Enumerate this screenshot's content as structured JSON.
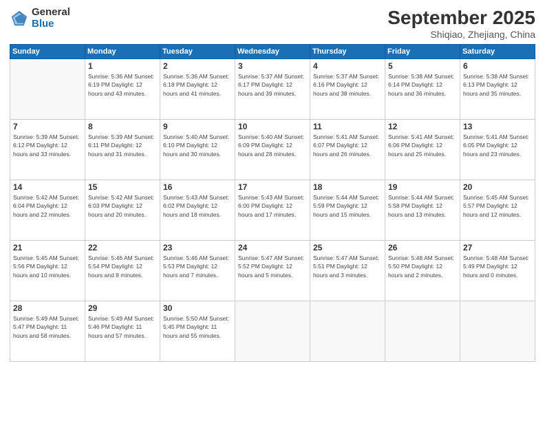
{
  "header": {
    "logo_general": "General",
    "logo_blue": "Blue",
    "month_title": "September 2025",
    "location": "Shiqiao, Zhejiang, China"
  },
  "weekdays": [
    "Sunday",
    "Monday",
    "Tuesday",
    "Wednesday",
    "Thursday",
    "Friday",
    "Saturday"
  ],
  "weeks": [
    [
      {
        "day": "",
        "info": ""
      },
      {
        "day": "1",
        "info": "Sunrise: 5:36 AM\nSunset: 6:19 PM\nDaylight: 12 hours\nand 43 minutes."
      },
      {
        "day": "2",
        "info": "Sunrise: 5:36 AM\nSunset: 6:18 PM\nDaylight: 12 hours\nand 41 minutes."
      },
      {
        "day": "3",
        "info": "Sunrise: 5:37 AM\nSunset: 6:17 PM\nDaylight: 12 hours\nand 39 minutes."
      },
      {
        "day": "4",
        "info": "Sunrise: 5:37 AM\nSunset: 6:16 PM\nDaylight: 12 hours\nand 38 minutes."
      },
      {
        "day": "5",
        "info": "Sunrise: 5:38 AM\nSunset: 6:14 PM\nDaylight: 12 hours\nand 36 minutes."
      },
      {
        "day": "6",
        "info": "Sunrise: 5:38 AM\nSunset: 6:13 PM\nDaylight: 12 hours\nand 35 minutes."
      }
    ],
    [
      {
        "day": "7",
        "info": "Sunrise: 5:39 AM\nSunset: 6:12 PM\nDaylight: 12 hours\nand 33 minutes."
      },
      {
        "day": "8",
        "info": "Sunrise: 5:39 AM\nSunset: 6:11 PM\nDaylight: 12 hours\nand 31 minutes."
      },
      {
        "day": "9",
        "info": "Sunrise: 5:40 AM\nSunset: 6:10 PM\nDaylight: 12 hours\nand 30 minutes."
      },
      {
        "day": "10",
        "info": "Sunrise: 5:40 AM\nSunset: 6:09 PM\nDaylight: 12 hours\nand 28 minutes."
      },
      {
        "day": "11",
        "info": "Sunrise: 5:41 AM\nSunset: 6:07 PM\nDaylight: 12 hours\nand 26 minutes."
      },
      {
        "day": "12",
        "info": "Sunrise: 5:41 AM\nSunset: 6:06 PM\nDaylight: 12 hours\nand 25 minutes."
      },
      {
        "day": "13",
        "info": "Sunrise: 5:41 AM\nSunset: 6:05 PM\nDaylight: 12 hours\nand 23 minutes."
      }
    ],
    [
      {
        "day": "14",
        "info": "Sunrise: 5:42 AM\nSunset: 6:04 PM\nDaylight: 12 hours\nand 22 minutes."
      },
      {
        "day": "15",
        "info": "Sunrise: 5:42 AM\nSunset: 6:03 PM\nDaylight: 12 hours\nand 20 minutes."
      },
      {
        "day": "16",
        "info": "Sunrise: 5:43 AM\nSunset: 6:02 PM\nDaylight: 12 hours\nand 18 minutes."
      },
      {
        "day": "17",
        "info": "Sunrise: 5:43 AM\nSunset: 6:00 PM\nDaylight: 12 hours\nand 17 minutes."
      },
      {
        "day": "18",
        "info": "Sunrise: 5:44 AM\nSunset: 5:59 PM\nDaylight: 12 hours\nand 15 minutes."
      },
      {
        "day": "19",
        "info": "Sunrise: 5:44 AM\nSunset: 5:58 PM\nDaylight: 12 hours\nand 13 minutes."
      },
      {
        "day": "20",
        "info": "Sunrise: 5:45 AM\nSunset: 5:57 PM\nDaylight: 12 hours\nand 12 minutes."
      }
    ],
    [
      {
        "day": "21",
        "info": "Sunrise: 5:45 AM\nSunset: 5:56 PM\nDaylight: 12 hours\nand 10 minutes."
      },
      {
        "day": "22",
        "info": "Sunrise: 5:46 AM\nSunset: 5:54 PM\nDaylight: 12 hours\nand 8 minutes."
      },
      {
        "day": "23",
        "info": "Sunrise: 5:46 AM\nSunset: 5:53 PM\nDaylight: 12 hours\nand 7 minutes."
      },
      {
        "day": "24",
        "info": "Sunrise: 5:47 AM\nSunset: 5:52 PM\nDaylight: 12 hours\nand 5 minutes."
      },
      {
        "day": "25",
        "info": "Sunrise: 5:47 AM\nSunset: 5:51 PM\nDaylight: 12 hours\nand 3 minutes."
      },
      {
        "day": "26",
        "info": "Sunrise: 5:48 AM\nSunset: 5:50 PM\nDaylight: 12 hours\nand 2 minutes."
      },
      {
        "day": "27",
        "info": "Sunrise: 5:48 AM\nSunset: 5:49 PM\nDaylight: 12 hours\nand 0 minutes."
      }
    ],
    [
      {
        "day": "28",
        "info": "Sunrise: 5:49 AM\nSunset: 5:47 PM\nDaylight: 11 hours\nand 58 minutes."
      },
      {
        "day": "29",
        "info": "Sunrise: 5:49 AM\nSunset: 5:46 PM\nDaylight: 11 hours\nand 57 minutes."
      },
      {
        "day": "30",
        "info": "Sunrise: 5:50 AM\nSunset: 5:45 PM\nDaylight: 11 hours\nand 55 minutes."
      },
      {
        "day": "",
        "info": ""
      },
      {
        "day": "",
        "info": ""
      },
      {
        "day": "",
        "info": ""
      },
      {
        "day": "",
        "info": ""
      }
    ]
  ]
}
